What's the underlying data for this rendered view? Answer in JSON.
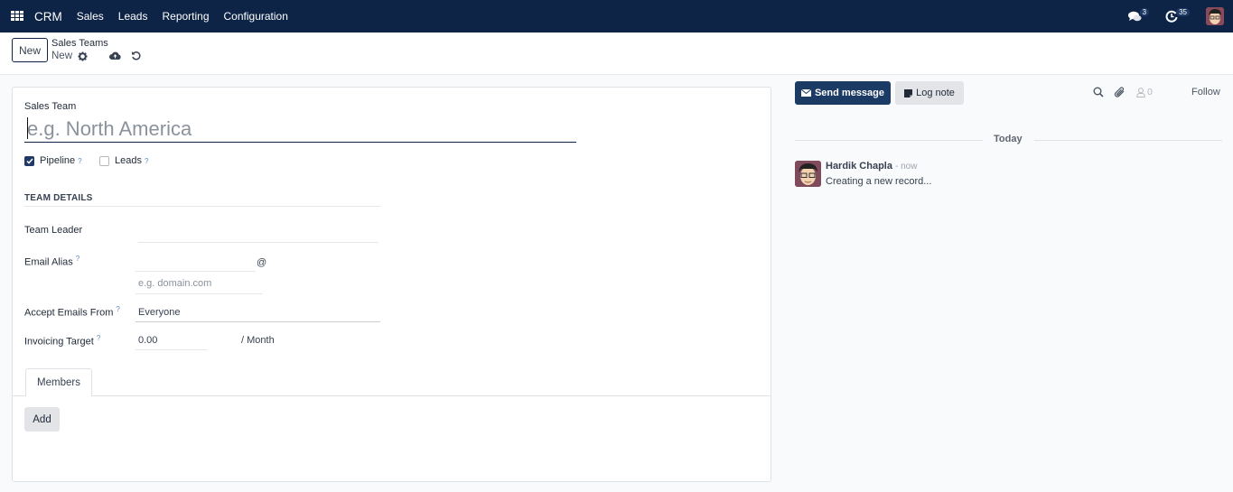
{
  "navbar": {
    "app_name": "CRM",
    "menu": [
      "Sales",
      "Leads",
      "Reporting",
      "Configuration"
    ],
    "messages_count": "3",
    "activities_count": "35",
    "icons": {
      "apps": "apps-grid-icon",
      "messages": "chat-bubbles-icon",
      "activities": "clock-icon",
      "user": "user-avatar"
    }
  },
  "control_panel": {
    "new_button": "New",
    "breadcrumb_parent": "Sales Teams",
    "breadcrumb_current": "New",
    "icons": {
      "settings": "gear-icon",
      "save": "cloud-upload-icon",
      "discard": "undo-icon"
    }
  },
  "form": {
    "name_label": "Sales Team",
    "name_placeholder": "e.g. North America",
    "name_value": "",
    "pipeline": {
      "label": "Pipeline",
      "help": "?",
      "checked": true
    },
    "leads": {
      "label": "Leads",
      "help": "?",
      "checked": false
    },
    "section_title": "TEAM DETAILS",
    "team_leader": {
      "label": "Team Leader",
      "value": ""
    },
    "email_alias": {
      "label": "Email Alias",
      "help": "?",
      "value": "",
      "at": "@",
      "domain_placeholder": "e.g. domain.com"
    },
    "accept_emails_from": {
      "label": "Accept Emails From",
      "help": "?",
      "value": "Everyone"
    },
    "invoicing_target": {
      "label": "Invoicing Target",
      "help": "?",
      "value": "0.00",
      "suffix": "/ Month"
    },
    "tabs": [
      {
        "label": "Members",
        "active": true
      }
    ],
    "add_button": "Add"
  },
  "chatter": {
    "send_message": "Send message",
    "log_note": "Log note",
    "followers_count": "0",
    "follow": "Follow",
    "date_separator": "Today",
    "messages": [
      {
        "author": "Hardik Chapla",
        "time": "- now",
        "body": "Creating a new record..."
      }
    ]
  },
  "colors": {
    "navbar_bg": "#0d2447",
    "primary_button": "#1b3a64",
    "secondary_button": "#e2e4e8",
    "page_bg": "#f9fafb"
  }
}
